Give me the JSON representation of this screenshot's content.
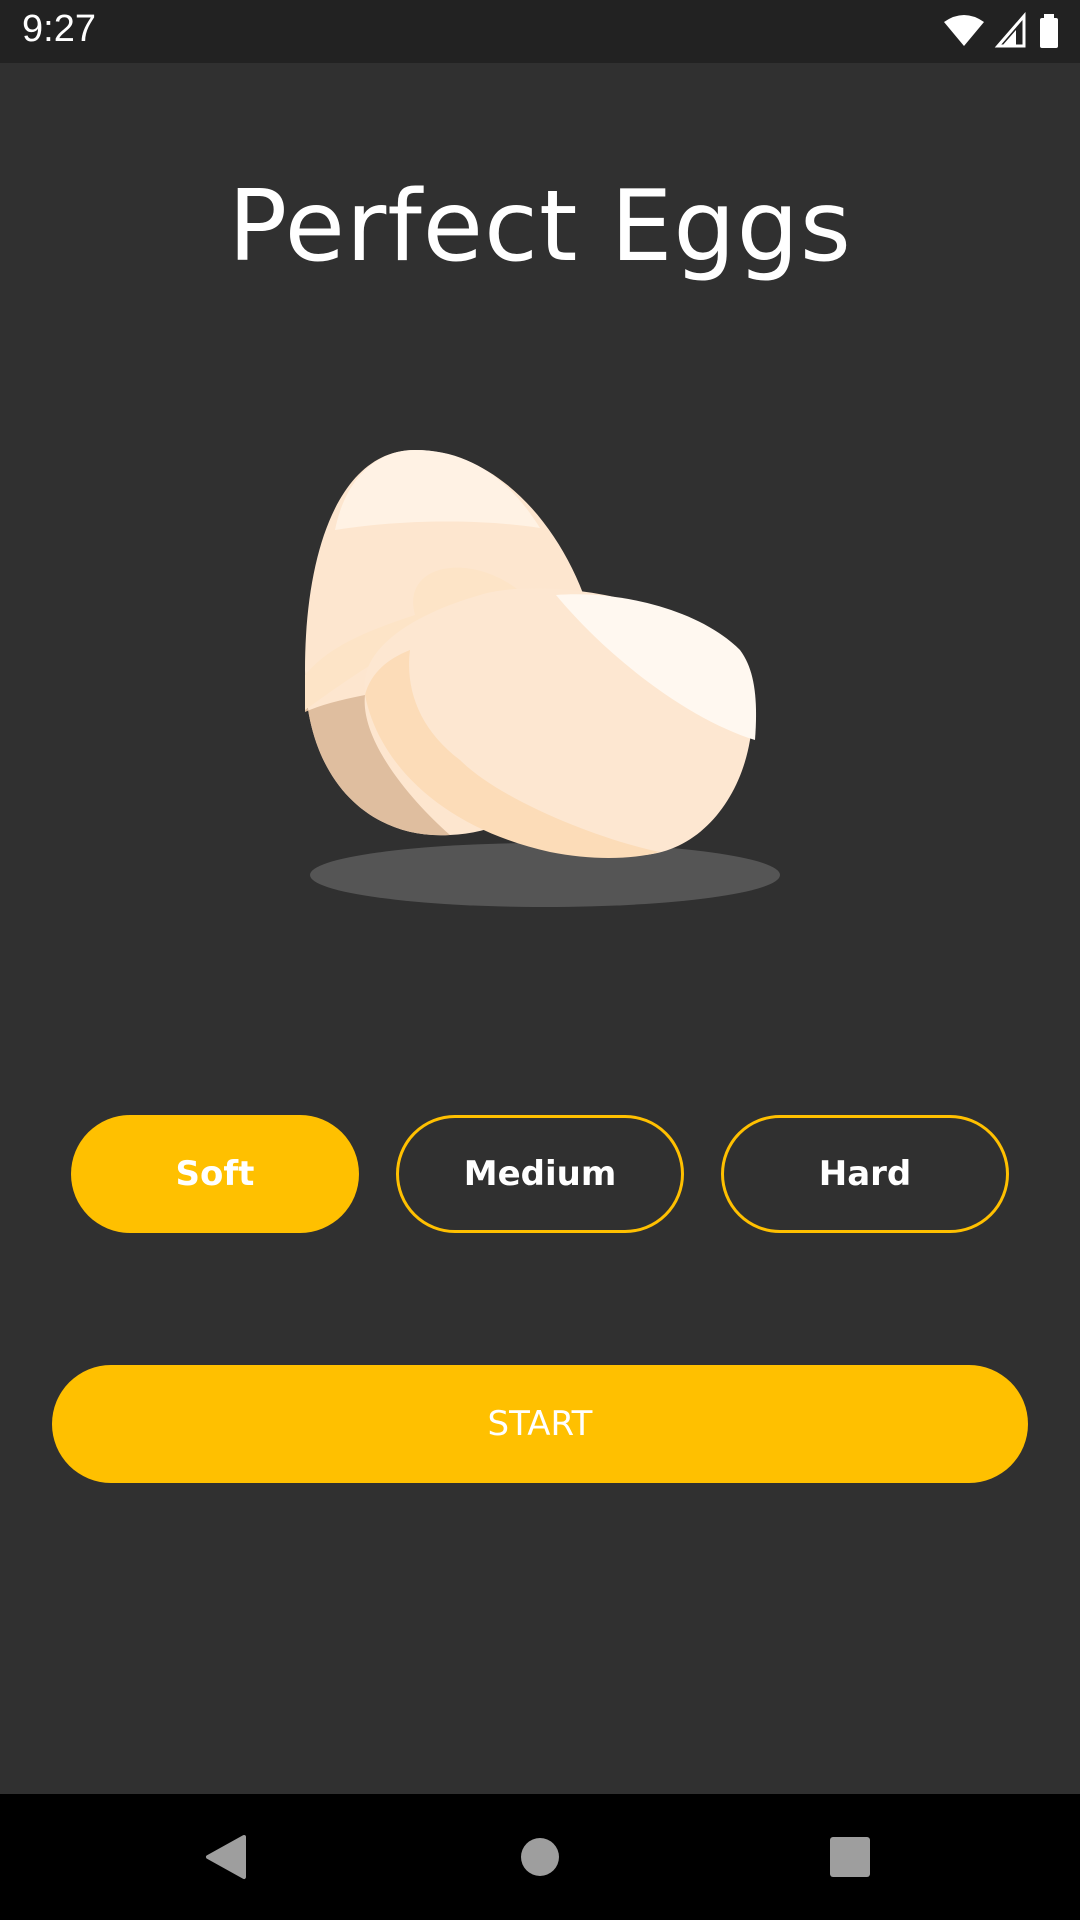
{
  "status_bar": {
    "time": "9:27",
    "icons": [
      "wifi-icon",
      "cell-signal-icon",
      "battery-icon"
    ]
  },
  "app": {
    "title": "Perfect Eggs"
  },
  "options": [
    {
      "label": "Soft",
      "selected": true
    },
    {
      "label": "Medium",
      "selected": false
    },
    {
      "label": "Hard",
      "selected": false
    }
  ],
  "start_label": "START",
  "colors": {
    "background": "#303030",
    "accent": "#ffc000",
    "text": "#ffffff"
  },
  "nav_bar": {
    "icons": [
      "back-icon",
      "home-icon",
      "recents-icon"
    ]
  }
}
